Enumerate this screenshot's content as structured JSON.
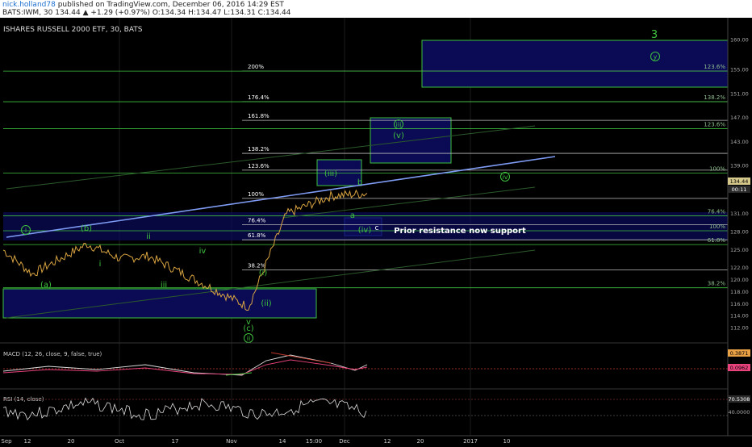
{
  "header": {
    "author": "nick.holland78",
    "published": "published on TradingView.com, December 06, 2016 14:29 EST",
    "quote": "BATS:IWM, 30  134.44  ▲ +1.29 (+0.97%)  O:134.34  H:134.47  L:134.31  C:134.44"
  },
  "chart_data": {
    "type": "line",
    "title": "ISHARES RUSSELL 2000 ETF, 30, BATS",
    "ylim": [
      111,
      161
    ],
    "yticks": [
      "160.00",
      "155.00",
      "151.00",
      "147.00",
      "143.00",
      "139.00",
      "135.00",
      "131.00",
      "128.00",
      "125.00",
      "122.00",
      "120.00",
      "118.00",
      "116.00",
      "114.00",
      "112.00"
    ],
    "xticks": [
      "Sep",
      "12",
      "20",
      "Oct",
      "17",
      "Nov",
      "14",
      "15:00",
      "Dec",
      "12",
      "20",
      "2017",
      "10"
    ],
    "x": [
      "Sep",
      "12",
      "20",
      "Oct",
      "17",
      "Nov",
      "14",
      "15:00",
      "Dec"
    ],
    "close": [
      125.0,
      121.0,
      126.0,
      123.5,
      124.0,
      115.5,
      131.0,
      134.0,
      134.44
    ],
    "price_badges": {
      "last": "134.44",
      "countdown": "00:11"
    },
    "fib_upper": [
      {
        "label": "200%",
        "price": 154.8
      },
      {
        "label": "176.4%",
        "price": 149.7
      },
      {
        "label": "161.8%",
        "price": 146.6
      },
      {
        "label": "138.2%",
        "price": 141.1
      },
      {
        "label": "123.6%",
        "price": 138.3
      },
      {
        "label": "100%",
        "price": 133.6
      },
      {
        "label": "76.4%",
        "price": 129.2
      },
      {
        "label": "61.8%",
        "price": 126.7
      },
      {
        "label": "38.2%",
        "price": 121.7
      }
    ],
    "fib_right": [
      {
        "label": "123.6%",
        "price": 154.8
      },
      {
        "label": "138.2%",
        "price": 149.7
      },
      {
        "label": "123.6%",
        "price": 145.2
      },
      {
        "label": "100%",
        "price": 137.8
      },
      {
        "label": "76.4%",
        "price": 130.7
      },
      {
        "label": "100%",
        "price": 128.2
      },
      {
        "label": "61.8%",
        "price": 125.9
      },
      {
        "label": "38.2%",
        "price": 118.7
      }
    ],
    "wave_labels": [
      "i",
      "(b)",
      "ii",
      "i",
      "iii",
      "(a)",
      "iv",
      "v",
      "(c)",
      "ii",
      "(i)",
      "(ii)",
      "(iii)",
      "a",
      "b",
      "c",
      "(iv)",
      "iii",
      "(v)",
      "iv",
      "y",
      "3"
    ],
    "annotation": "Prior resistance now support",
    "macd": {
      "title": "MACD (12, 26, close, 9, false, true)",
      "badges": [
        "0.3871",
        "0.0962"
      ]
    },
    "rsi": {
      "title": "RSI (14, close)",
      "badges": [
        "70.5308",
        "40.0000"
      ]
    }
  }
}
